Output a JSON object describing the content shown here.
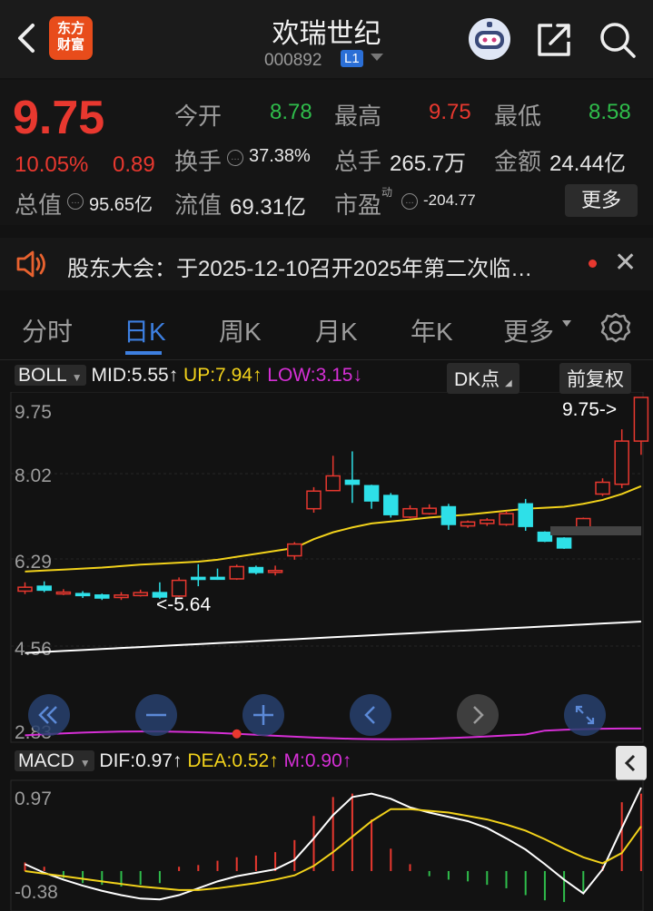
{
  "header": {
    "title": "欢瑞世纪",
    "code": "000892",
    "level": "L1",
    "logo_text": "东方财富"
  },
  "quote": {
    "price": "9.75",
    "change_pct": "10.05%",
    "change_abs": "0.89",
    "open_label": "今开",
    "open_value": "8.78",
    "high_label": "最高",
    "high_value": "9.75",
    "low_label": "最低",
    "low_value": "8.58",
    "turnover_label": "换手",
    "turnover_value": "37.38%",
    "volume_label": "总手",
    "volume_value": "265.7万",
    "amount_label": "金额",
    "amount_value": "24.44亿",
    "mktcap_label": "总值",
    "mktcap_value": "95.65亿",
    "float_label": "流值",
    "float_value": "69.31亿",
    "pe_label": "市盈",
    "pe_sup": "动",
    "pe_value": "-204.77",
    "more_button": "更多",
    "colors": {
      "up": "#e8382f",
      "down": "#2fbd4b"
    }
  },
  "notice": {
    "text": "股东大会：于2025-12-10召开2025年第二次临…"
  },
  "tabs": [
    {
      "label": "分时"
    },
    {
      "label": "日K"
    },
    {
      "label": "周K"
    },
    {
      "label": "月K"
    },
    {
      "label": "年K"
    },
    {
      "label": "更多"
    }
  ],
  "active_tab": "日K",
  "boll": {
    "name": "BOLL",
    "mid": "MID:5.55",
    "up": "UP:7.94",
    "low": "LOW:3.15",
    "dk": "DK点",
    "adjust": "前复权",
    "y_labels": [
      "9.75",
      "8.02",
      "6.29",
      "4.56",
      "2.83"
    ],
    "max_annotation": "9.75->",
    "min_annotation": "<-5.64"
  },
  "macd": {
    "name": "MACD",
    "dif": "DIF:0.97",
    "dea": "DEA:0.52",
    "m": "M:0.90",
    "y_labels": [
      "0.97",
      "-0.38"
    ]
  },
  "chart_data": {
    "type": "candlestick",
    "title": "",
    "y_range": [
      2.83,
      9.75
    ],
    "candles": [
      {
        "o": 5.8,
        "c": 5.88,
        "h": 5.98,
        "l": 5.74
      },
      {
        "o": 5.9,
        "c": 5.82,
        "h": 6.0,
        "l": 5.78
      },
      {
        "o": 5.78,
        "c": 5.78,
        "h": 5.84,
        "l": 5.72
      },
      {
        "o": 5.75,
        "c": 5.71,
        "h": 5.8,
        "l": 5.66
      },
      {
        "o": 5.72,
        "c": 5.66,
        "h": 5.75,
        "l": 5.62
      },
      {
        "o": 5.67,
        "c": 5.72,
        "h": 5.78,
        "l": 5.62
      },
      {
        "o": 5.71,
        "c": 5.77,
        "h": 5.83,
        "l": 5.69
      },
      {
        "o": 5.77,
        "c": 5.68,
        "h": 5.98,
        "l": 5.64
      },
      {
        "o": 5.7,
        "c": 6.02,
        "h": 6.08,
        "l": 5.68
      },
      {
        "o": 6.08,
        "c": 6.04,
        "h": 6.35,
        "l": 5.9
      },
      {
        "o": 6.08,
        "c": 6.07,
        "h": 6.26,
        "l": 6.03
      },
      {
        "o": 6.05,
        "c": 6.3,
        "h": 6.34,
        "l": 6.03
      },
      {
        "o": 6.28,
        "c": 6.18,
        "h": 6.32,
        "l": 6.14
      },
      {
        "o": 6.22,
        "c": 6.22,
        "h": 6.32,
        "l": 6.12
      },
      {
        "o": 6.52,
        "c": 6.76,
        "h": 6.8,
        "l": 6.44
      },
      {
        "o": 7.48,
        "c": 7.84,
        "h": 7.92,
        "l": 7.4
      },
      {
        "o": 7.85,
        "c": 8.15,
        "h": 8.56,
        "l": 7.86
      },
      {
        "o": 8.06,
        "c": 7.98,
        "h": 8.65,
        "l": 7.6
      },
      {
        "o": 7.95,
        "c": 7.64,
        "h": 7.97,
        "l": 7.48
      },
      {
        "o": 7.75,
        "c": 7.36,
        "h": 7.8,
        "l": 7.3
      },
      {
        "o": 7.31,
        "c": 7.48,
        "h": 7.55,
        "l": 7.29
      },
      {
        "o": 7.38,
        "c": 7.49,
        "h": 7.57,
        "l": 7.36
      },
      {
        "o": 7.52,
        "c": 7.16,
        "h": 7.58,
        "l": 7.05
      },
      {
        "o": 7.13,
        "c": 7.21,
        "h": 7.24,
        "l": 7.09
      },
      {
        "o": 7.18,
        "c": 7.25,
        "h": 7.29,
        "l": 7.13
      },
      {
        "o": 7.16,
        "c": 7.38,
        "h": 7.43,
        "l": 7.13
      },
      {
        "o": 7.58,
        "c": 7.12,
        "h": 7.68,
        "l": 7.03
      },
      {
        "o": 7.0,
        "c": 6.82,
        "h": 7.02,
        "l": 6.8
      },
      {
        "o": 6.88,
        "c": 6.68,
        "h": 6.9,
        "l": 6.66
      },
      {
        "o": 7.08,
        "c": 7.28,
        "h": 7.3,
        "l": 7.02
      },
      {
        "o": 7.78,
        "c": 8.02,
        "h": 8.1,
        "l": 7.74
      },
      {
        "o": 7.98,
        "c": 8.86,
        "h": 9.1,
        "l": 7.9
      },
      {
        "o": 8.86,
        "c": 9.75,
        "h": 9.75,
        "l": 8.58
      }
    ],
    "boll_up": [
      6.2,
      6.22,
      6.24,
      6.26,
      6.28,
      6.31,
      6.34,
      6.36,
      6.38,
      6.4,
      6.44,
      6.5,
      6.56,
      6.62,
      6.68,
      6.86,
      7.0,
      7.1,
      7.18,
      7.22,
      7.26,
      7.3,
      7.33,
      7.36,
      7.4,
      7.44,
      7.48,
      7.5,
      7.52,
      7.58,
      7.66,
      7.78,
      7.94
    ],
    "boll_low": [
      4.54,
      4.56,
      4.58,
      4.6,
      4.62,
      4.64,
      4.66,
      4.68,
      4.7,
      4.72,
      4.74,
      4.76,
      4.78,
      4.8,
      4.82,
      4.84,
      4.86,
      4.88,
      4.9,
      4.92,
      4.94,
      4.96,
      4.98,
      5.0,
      5.02,
      5.04,
      5.06,
      5.08,
      5.1,
      5.12,
      5.14,
      5.16,
      5.18
    ],
    "mid_range": [
      2.83,
      3.15
    ],
    "macd_range": [
      -0.38,
      0.97
    ],
    "dif": [
      0.08,
      -0.02,
      -0.1,
      -0.17,
      -0.23,
      -0.28,
      -0.32,
      -0.33,
      -0.28,
      -0.2,
      -0.12,
      -0.06,
      -0.02,
      0.02,
      0.13,
      0.38,
      0.65,
      0.86,
      0.9,
      0.84,
      0.74,
      0.68,
      0.63,
      0.58,
      0.5,
      0.38,
      0.25,
      0.08,
      -0.1,
      -0.26,
      0.02,
      0.5,
      0.97
    ],
    "dea": [
      0.0,
      -0.03,
      -0.06,
      -0.09,
      -0.12,
      -0.15,
      -0.18,
      -0.2,
      -0.22,
      -0.22,
      -0.2,
      -0.17,
      -0.14,
      -0.1,
      -0.05,
      0.06,
      0.22,
      0.4,
      0.58,
      0.72,
      0.72,
      0.7,
      0.68,
      0.64,
      0.6,
      0.54,
      0.47,
      0.37,
      0.26,
      0.16,
      0.09,
      0.21,
      0.52
    ],
    "macd_hist": [
      0.1,
      0.05,
      -0.08,
      -0.14,
      -0.16,
      -0.18,
      -0.16,
      -0.14,
      0.05,
      0.07,
      0.12,
      0.16,
      0.18,
      0.22,
      0.36,
      0.64,
      0.86,
      0.9,
      0.6,
      0.26,
      0.08,
      -0.06,
      -0.1,
      -0.12,
      -0.16,
      -0.2,
      -0.28,
      -0.34,
      -0.36,
      -0.24,
      0.06,
      0.8,
      0.9
    ]
  }
}
